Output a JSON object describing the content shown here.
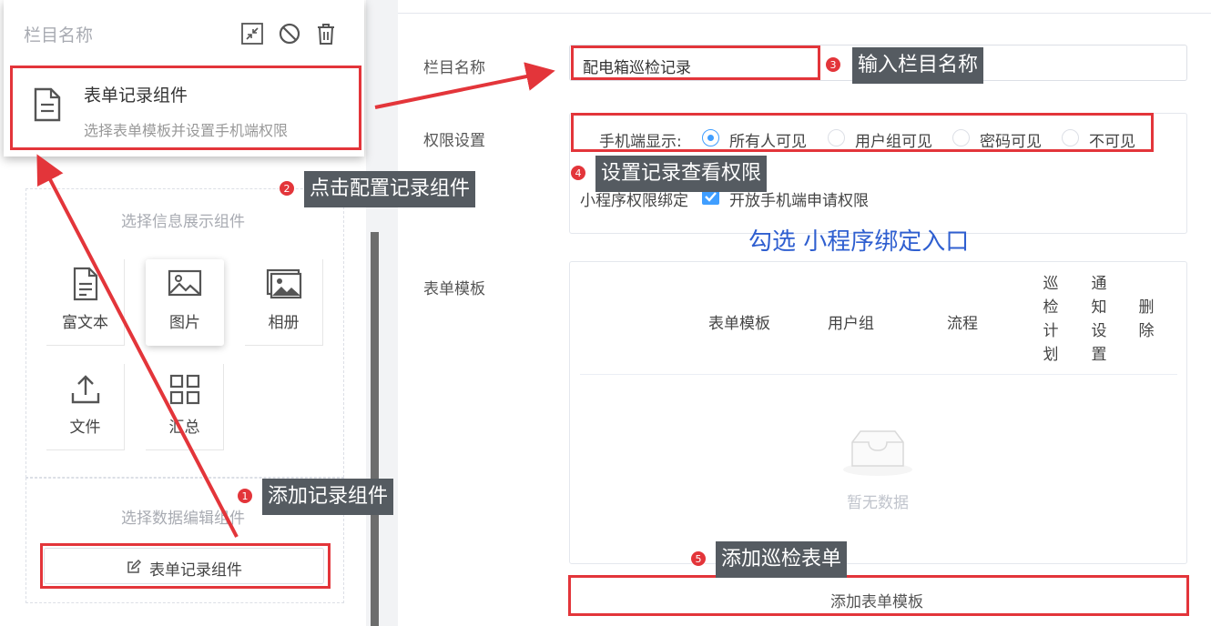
{
  "popup": {
    "title": "栏目名称",
    "icons": [
      "shrink-icon",
      "ban-icon",
      "trash-icon"
    ],
    "item": {
      "title": "表单记录组件",
      "desc": "选择表单模板并设置手机端权限",
      "icon": "document-icon"
    }
  },
  "display_section": {
    "title": "选择信息展示组件",
    "tiles": [
      {
        "label": "富文本",
        "icon": "rich-text-icon"
      },
      {
        "label": "图片",
        "icon": "image-icon"
      },
      {
        "label": "相册",
        "icon": "album-icon"
      },
      {
        "label": "文件",
        "icon": "upload-icon"
      },
      {
        "label": "汇总",
        "icon": "grid-icon"
      }
    ]
  },
  "edit_section": {
    "title": "选择数据编辑组件",
    "button": "表单记录组件"
  },
  "form": {
    "name_label": "栏目名称",
    "name_value": "配电箱巡检记录",
    "perm_label": "权限设置",
    "mobile_display_label": "手机端显示:",
    "radio_options": [
      "所有人可见",
      "用户组可见",
      "密码可见",
      "不可见"
    ],
    "selected_option": "所有人可见",
    "mini_label": "小程序权限绑定",
    "checkbox_label": "开放手机端申请权限",
    "checkbox_checked": true,
    "template_label": "表单模板",
    "columns": [
      "表单模板",
      "用户组",
      "流程",
      "巡检计划",
      "通知设置",
      "删除"
    ],
    "vertical_cols": [
      [
        "巡",
        "检",
        "计",
        "划"
      ],
      [
        "通",
        "知",
        "设",
        "置"
      ],
      [
        "删",
        "除"
      ]
    ],
    "empty_text": "暂无数据",
    "add_button": "添加表单模板"
  },
  "annotations": {
    "step1": {
      "num": "1",
      "text": "添加记录组件"
    },
    "step2": {
      "num": "2",
      "text": "点击配置记录组件"
    },
    "step3": {
      "num": "3",
      "text": "输入栏目名称"
    },
    "step4": {
      "num": "4",
      "text": "设置记录查看权限"
    },
    "step5": {
      "num": "5",
      "text": "添加巡检表单"
    },
    "note": "勾选 小程序绑定入口",
    "accent": "#e3353a",
    "tag_bg": "#555b61",
    "note_color": "#2f5fd0"
  }
}
